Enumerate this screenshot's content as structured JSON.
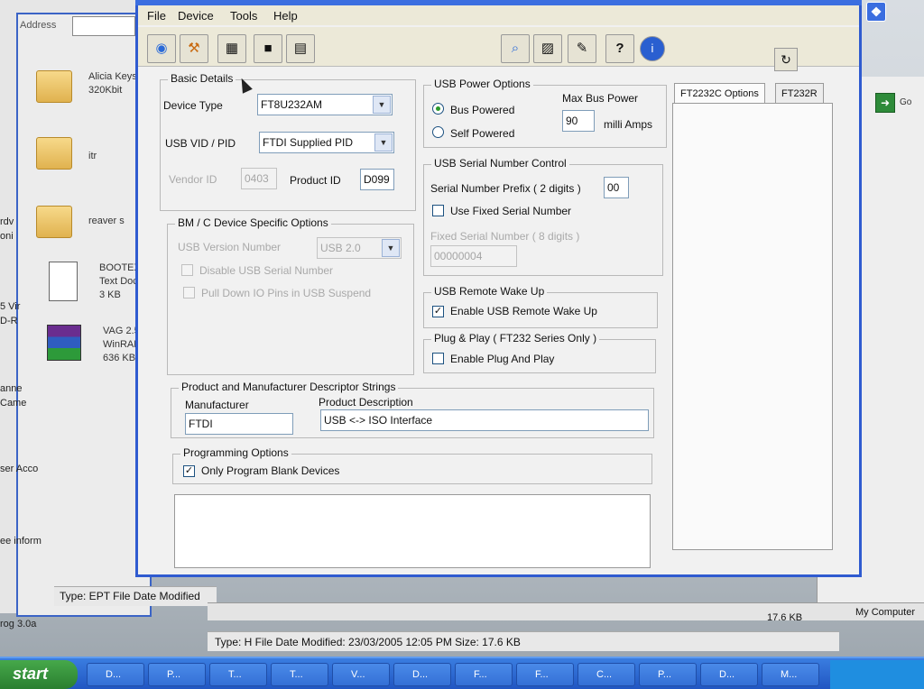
{
  "background": {
    "address_label": "Address",
    "files": [
      {
        "name": "Alicia Keys",
        "sub": "320Kbit",
        "icon": "folder-icon"
      },
      {
        "name": "itr",
        "sub": "",
        "icon": "folder-icon"
      },
      {
        "name": "reaver s",
        "sub": "",
        "icon": "folder-icon"
      },
      {
        "name": "BOOTEX",
        "sub": "Text Doc",
        "size": "3 KB",
        "icon": "text-document-icon"
      },
      {
        "name": "VAG 2.5",
        "sub": "WinRAR",
        "size": "636 KB",
        "icon": "winrar-archive-icon"
      }
    ],
    "left_fragments": [
      "rdv",
      "oni",
      "5 Vir",
      "D-R",
      "anne",
      "Came",
      "ser Acco",
      "ee inform",
      "rog 3.0a"
    ],
    "status_left": "Type: EPT File Date Modified",
    "status_bottom": "Type: H File Date Modified: 23/03/2005 12:05 PM Size: 17.6 KB",
    "size_right": "17.6 KB",
    "my_computer": "My Computer",
    "go_label": "Go",
    "taskbar": {
      "start": "start",
      "tasks": [
        "D...",
        "P...",
        "T...",
        "T...",
        "V...",
        "D...",
        "F...",
        "F...",
        "C...",
        "P...",
        "D...",
        "M..."
      ]
    }
  },
  "dialog": {
    "menu": [
      "File",
      "Device",
      "Tools",
      "Help"
    ],
    "toolbar_icons": [
      "globe-icon",
      "tools-icon",
      "program-icon",
      "stop-icon",
      "save-icon",
      "search-icon",
      "erase-icon",
      "pen-icon",
      "help-icon",
      "info-icon"
    ],
    "toolbar_help": "?",
    "basic_details": {
      "title": "Basic Details",
      "device_type_label": "Device Type",
      "device_type_value": "FT8U232AM",
      "usb_vid_pid_label": "USB VID / PID",
      "usb_vid_pid_value": "FTDI Supplied PID",
      "vendor_id_label": "Vendor ID",
      "vendor_id_value": "0403",
      "product_id_label": "Product ID",
      "product_id_value": "D099"
    },
    "bm_options": {
      "title": "BM / C Device Specific Options",
      "usb_version_label": "USB Version Number",
      "usb_version_value": "USB 2.0",
      "disable_serial": "Disable USB Serial Number",
      "pull_down": "Pull Down IO Pins in USB Suspend"
    },
    "usb_power": {
      "title": "USB Power Options",
      "bus_powered": "Bus Powered",
      "self_powered": "Self Powered",
      "max_bus_power_label": "Max Bus Power",
      "max_bus_power_value": "90",
      "unit": "milli Amps"
    },
    "serial_control": {
      "title": "USB Serial Number Control",
      "prefix_label": "Serial Number Prefix ( 2 digits )",
      "prefix_value": "00",
      "use_fixed": "Use Fixed Serial Number",
      "fixed_label": "Fixed Serial Number ( 8 digits )",
      "fixed_value": "00000004"
    },
    "remote_wake": {
      "title": "USB Remote Wake Up",
      "enable": "Enable USB Remote Wake Up",
      "checked": true
    },
    "plug_play": {
      "title": "Plug & Play  ( FT232 Series Only )",
      "enable": "Enable Plug And Play",
      "checked": false
    },
    "descriptors": {
      "title": "Product and Manufacturer Descriptor Strings",
      "manufacturer_label": "Manufacturer",
      "manufacturer_value": "FTDI",
      "product_desc_label": "Product Description",
      "product_desc_value": "USB <-> ISO Interface"
    },
    "programming": {
      "title": "Programming Options",
      "blank_only": "Only Program Blank Devices",
      "checked": true
    },
    "tabs": [
      "FT2232C Options",
      "FT232R"
    ]
  }
}
